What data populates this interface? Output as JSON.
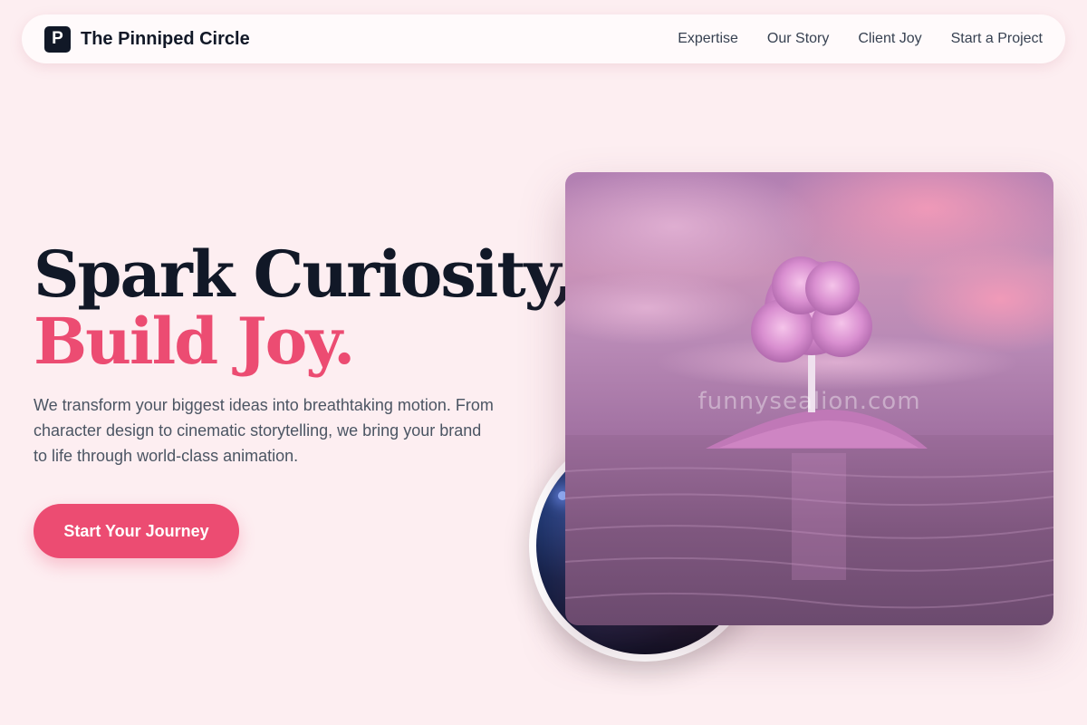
{
  "brand": {
    "mark": "P",
    "name": "The Pinniped Circle"
  },
  "nav": {
    "links": [
      "Expertise",
      "Our Story",
      "Client Joy",
      "Start a Project"
    ]
  },
  "hero": {
    "title_line1": "Spark Curiosity,",
    "title_line2": "Build Joy.",
    "description": "We transform your biggest ideas into breathtaking motion. From character design to cinematic storytelling, we bring your brand to life through world-class animation.",
    "cta_label": "Start Your Journey"
  },
  "images": {
    "watermark": "funnysealion.com"
  },
  "colors": {
    "background": "#fdeef1",
    "accent": "#ec4c72",
    "dark": "#111827",
    "muted": "#4b5563"
  }
}
